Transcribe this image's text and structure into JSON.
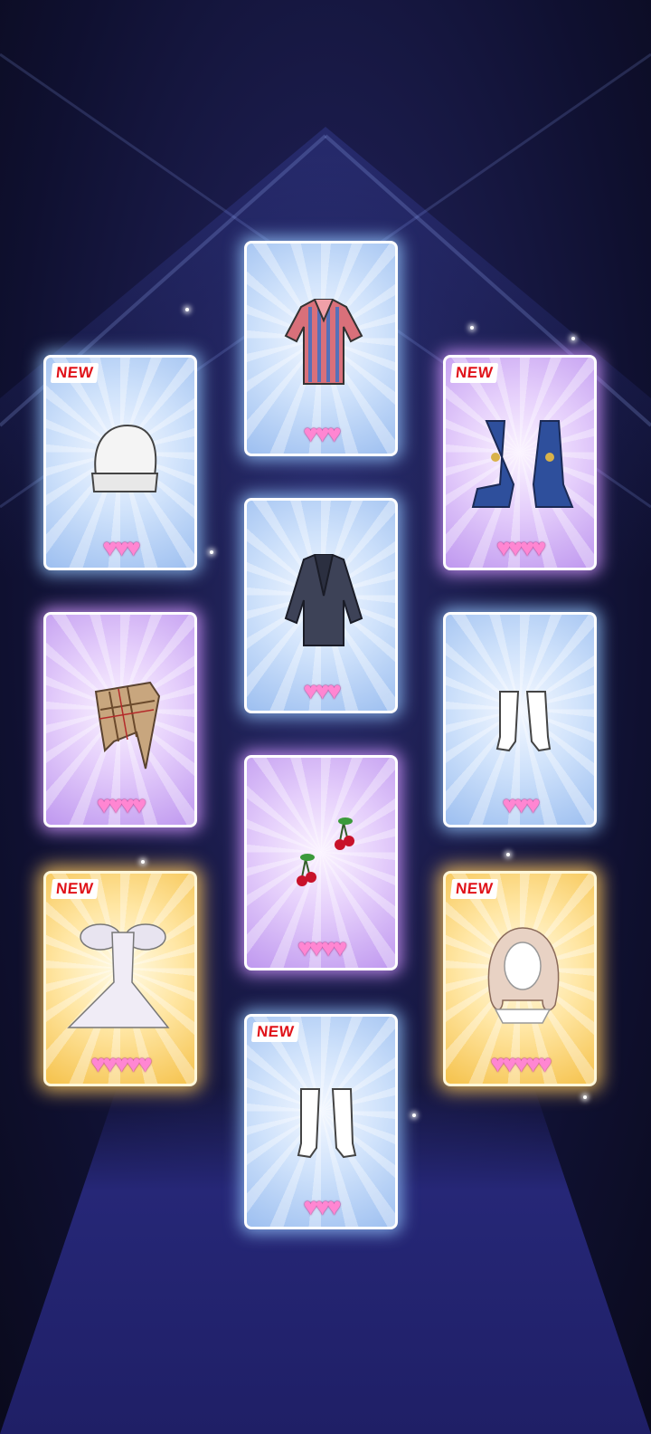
{
  "new_label": "NEW",
  "cards": [
    {
      "id": "striped-shirt",
      "new": false,
      "hearts": "♥♥♥",
      "theme": "blue"
    },
    {
      "id": "white-beanie",
      "new": true,
      "hearts": "♥♥♥",
      "theme": "blue"
    },
    {
      "id": "platform-heels",
      "new": true,
      "hearts": "♥♥♥♥",
      "theme": "purple"
    },
    {
      "id": "navy-blazer",
      "new": false,
      "hearts": "♥♥♥",
      "theme": "blue"
    },
    {
      "id": "plaid-scarf",
      "new": false,
      "hearts": "♥♥♥♥",
      "theme": "purple"
    },
    {
      "id": "white-socks",
      "new": false,
      "hearts": "♥♥♥",
      "theme": "blue"
    },
    {
      "id": "cherry-earrings",
      "new": false,
      "hearts": "♥♥♥♥",
      "theme": "purple"
    },
    {
      "id": "feather-gown",
      "new": true,
      "hearts": "♥♥♥♥♥",
      "theme": "gold"
    },
    {
      "id": "wavy-hair",
      "new": true,
      "hearts": "♥♥♥♥♥",
      "theme": "gold"
    },
    {
      "id": "ankle-socks",
      "new": true,
      "hearts": "♥♥♥",
      "theme": "blue"
    }
  ]
}
